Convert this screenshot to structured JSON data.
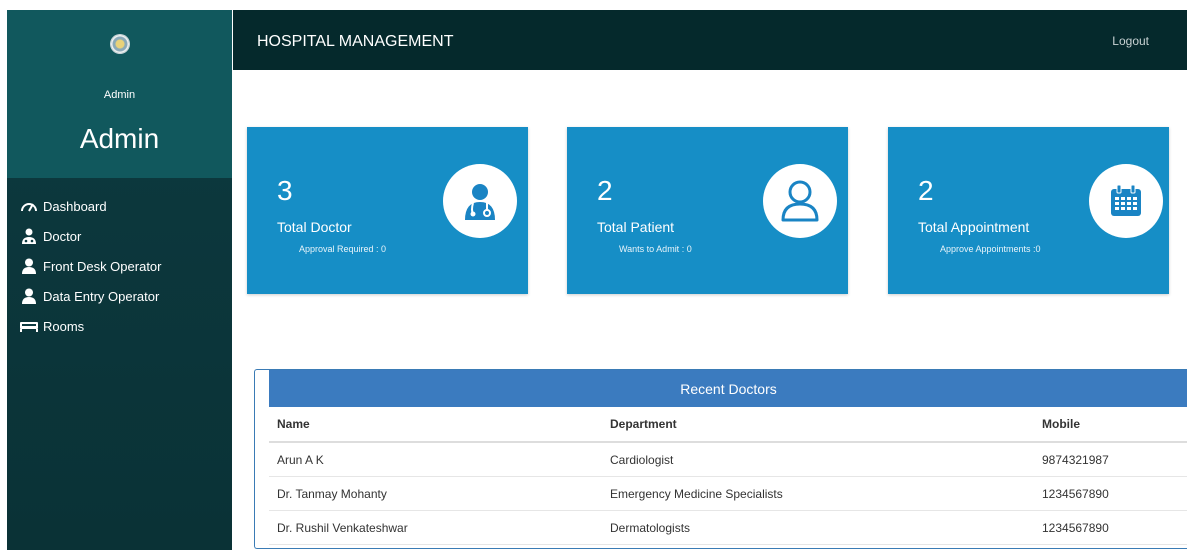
{
  "sidebar": {
    "user_small": "Admin",
    "user_big": "Admin",
    "items": [
      {
        "label": "Dashboard",
        "icon": "dashboard-gauge-icon"
      },
      {
        "label": "Doctor",
        "icon": "doctor-icon"
      },
      {
        "label": "Front Desk Operator",
        "icon": "user-icon"
      },
      {
        "label": "Data Entry Operator",
        "icon": "user-icon"
      },
      {
        "label": "Rooms",
        "icon": "bed-icon"
      }
    ]
  },
  "header": {
    "title": "HOSPITAL MANAGEMENT",
    "logout": "Logout"
  },
  "cards": [
    {
      "value": "3",
      "title": "Total Doctor",
      "sub": "Approval Required : 0",
      "icon": "doctor-icon"
    },
    {
      "value": "2",
      "title": "Total Patient",
      "sub": "Wants to Admit : 0",
      "icon": "user-outline-icon"
    },
    {
      "value": "2",
      "title": "Total Appointment",
      "sub": "Approve Appointments :0",
      "icon": "calendar-icon"
    }
  ],
  "recent_doctors": {
    "title": "Recent Doctors",
    "columns": [
      "Name",
      "Department",
      "Mobile"
    ],
    "rows": [
      [
        "Arun A K",
        "Cardiologist",
        "9874321987"
      ],
      [
        "Dr. Tanmay Mohanty",
        "Emergency Medicine Specialists",
        "1234567890"
      ],
      [
        "Dr. Rushil Venkateshwar",
        "Dermatologists",
        "1234567890"
      ]
    ]
  },
  "colors": {
    "sidebar_top": "#11585d",
    "sidebar": "#0d3a40",
    "header": "#05292c",
    "card": "#168ec6",
    "table_head": "#3b7bbf"
  }
}
